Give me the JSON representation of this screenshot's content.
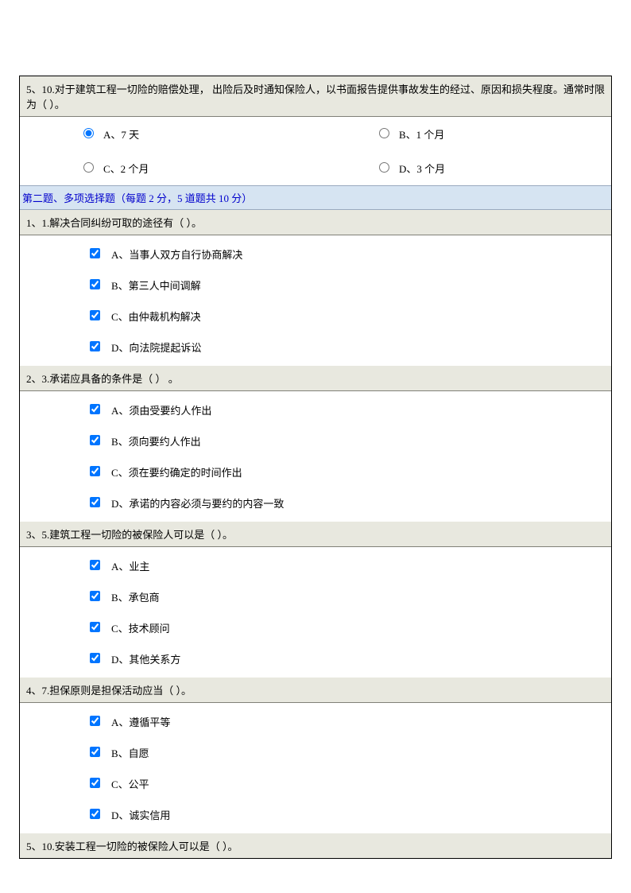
{
  "singleChoice": {
    "q5": {
      "header": "5、10.对于建筑工程一切险的赔偿处理，  出险后及时通知保险人，以书面报告提供事故发生的经过、原因和损失程度。通常时限为（  ）。",
      "options": {
        "a": "A、7 天",
        "b": "B、1 个月",
        "c": "C、2 个月",
        "d": "D、3 个月"
      }
    }
  },
  "sectionHeader": "第二题、多项选择题（每题 2 分，5 道题共 10 分）",
  "multiChoice": {
    "q1": {
      "header": "1、1.解决合同纠纷可取的途径有（  ）。",
      "options": {
        "a": "A、当事人双方自行协商解决",
        "b": "B、第三人中间调解",
        "c": "C、由仲裁机构解决",
        "d": "D、向法院提起诉讼"
      }
    },
    "q2": {
      "header": "2、3.承诺应具备的条件是（  ） 。",
      "options": {
        "a": "A、须由受要约人作出",
        "b": "B、须向要约人作出",
        "c": "C、须在要约确定的时间作出",
        "d": "D、承诺的内容必须与要约的内容一致"
      }
    },
    "q3": {
      "header": "3、5.建筑工程一切险的被保险人可以是（  ）。",
      "options": {
        "a": "A、业主",
        "b": "B、承包商",
        "c": "C、技术顾问",
        "d": "D、其他关系方"
      }
    },
    "q4": {
      "header": "4、7.担保原则是担保活动应当（  ）。",
      "options": {
        "a": "A、遵循平等",
        "b": "B、自愿",
        "c": "C、公平",
        "d": "D、诚实信用"
      }
    },
    "q5": {
      "header": "5、10.安装工程一切险的被保险人可以是（  ）。"
    }
  }
}
